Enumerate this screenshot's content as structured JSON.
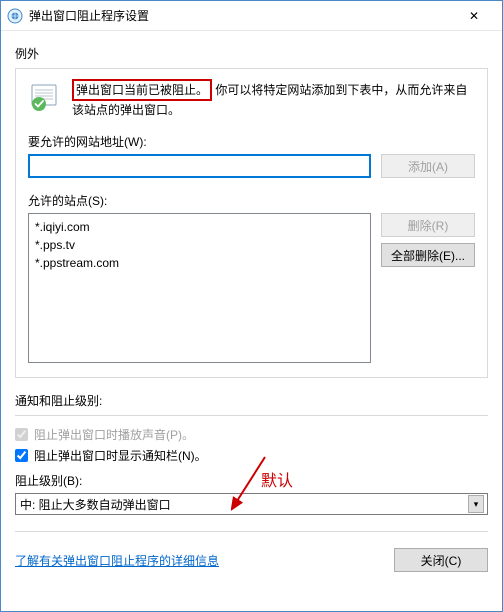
{
  "window": {
    "title": "弹出窗口阻止程序设置",
    "close_glyph": "✕"
  },
  "exceptions": {
    "heading": "例外",
    "info_highlight": "弹出窗口当前已被阻止。",
    "info_rest": "你可以将特定网站添加到下表中，从而允许来自该站点的弹出窗口。",
    "address_label": "要允许的网站地址(W):",
    "address_value": "",
    "add_button": "添加(A)",
    "allowed_label": "允许的站点(S):",
    "sites": [
      "*.iqiyi.com",
      "*.pps.tv",
      "*.ppstream.com"
    ],
    "remove_button": "删除(R)",
    "remove_all_button": "全部删除(E)..."
  },
  "notify": {
    "heading": "通知和阻止级别:",
    "sound_label": "阻止弹出窗口时播放声音(P)。",
    "bar_label": "阻止弹出窗口时显示通知栏(N)。",
    "level_label": "阻止级别(B):",
    "combo_value": "中: 阻止大多数自动弹出窗口",
    "annotation": "默认"
  },
  "footer": {
    "link": "了解有关弹出窗口阻止程序的详细信息",
    "close_button": "关闭(C)"
  }
}
